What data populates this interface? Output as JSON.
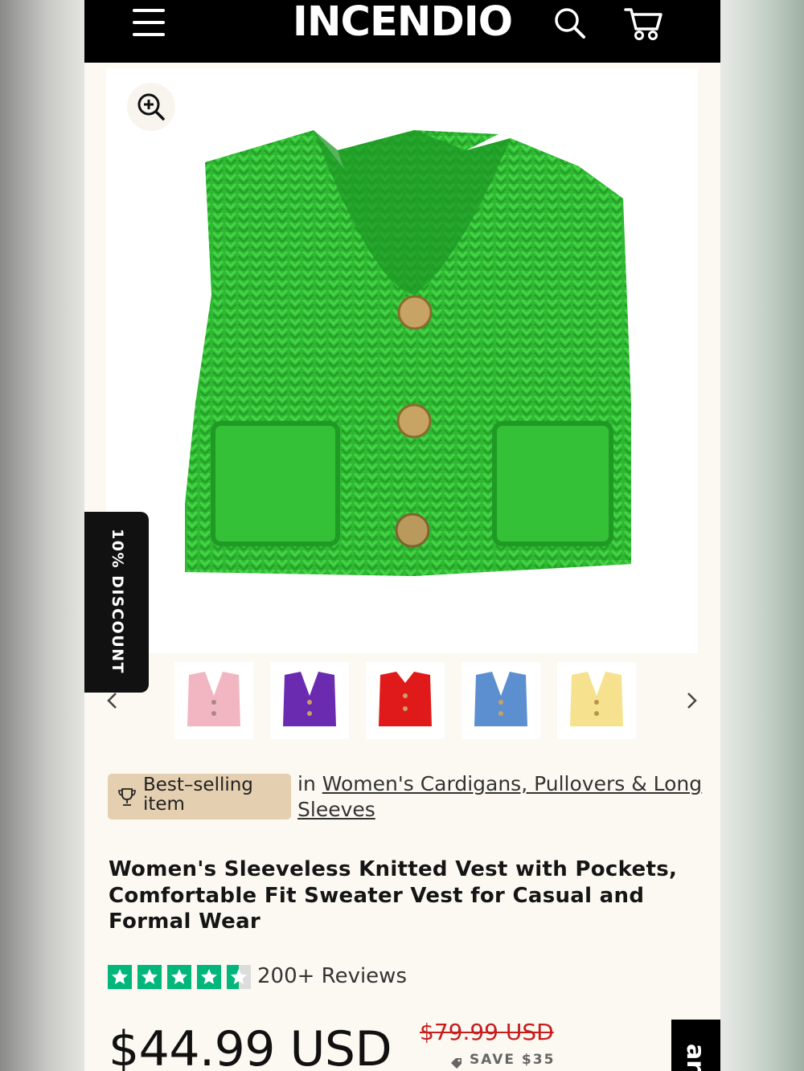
{
  "header": {
    "logo": "INCENDIO",
    "icons": [
      "menu-icon",
      "search-icon",
      "cart-icon"
    ]
  },
  "promo_tab": {
    "label": "10% DISCOUNT"
  },
  "gallery": {
    "main_image_alt": "green knitted vest",
    "zoom_icon": "zoom-in-icon",
    "thumbnails": [
      {
        "color_name": "pink",
        "hex": "#f2b6c2"
      },
      {
        "color_name": "purple",
        "hex": "#6a2bb0"
      },
      {
        "color_name": "red",
        "hex": "#e01a1a"
      },
      {
        "color_name": "blue",
        "hex": "#5b8fd0"
      },
      {
        "color_name": "yellow",
        "hex": "#f6e28e"
      }
    ],
    "prev_icon": "chevron-left-icon",
    "next_icon": "chevron-right-icon"
  },
  "badge": {
    "label": "Best–selling item",
    "icon": "trophy-icon",
    "color": "#e4cfb0"
  },
  "category": {
    "prefix": "in",
    "link": "Women's Cardigans, Pullovers & Long Sleeves"
  },
  "product": {
    "title": "Women's Sleeveless Knitted Vest with Pockets, Comfortable Fit Sweater Vest for Casual and Formal Wear",
    "rating": 4.5,
    "rating_max": 5,
    "reviews": "200+ Reviews",
    "star_color": "#00b67a",
    "price": "$44.99 USD",
    "compare_price": "$79.99 USD",
    "save": "SAVE $35",
    "compare_color": "#c71d1d"
  },
  "cart_tab": {
    "label": "art"
  }
}
